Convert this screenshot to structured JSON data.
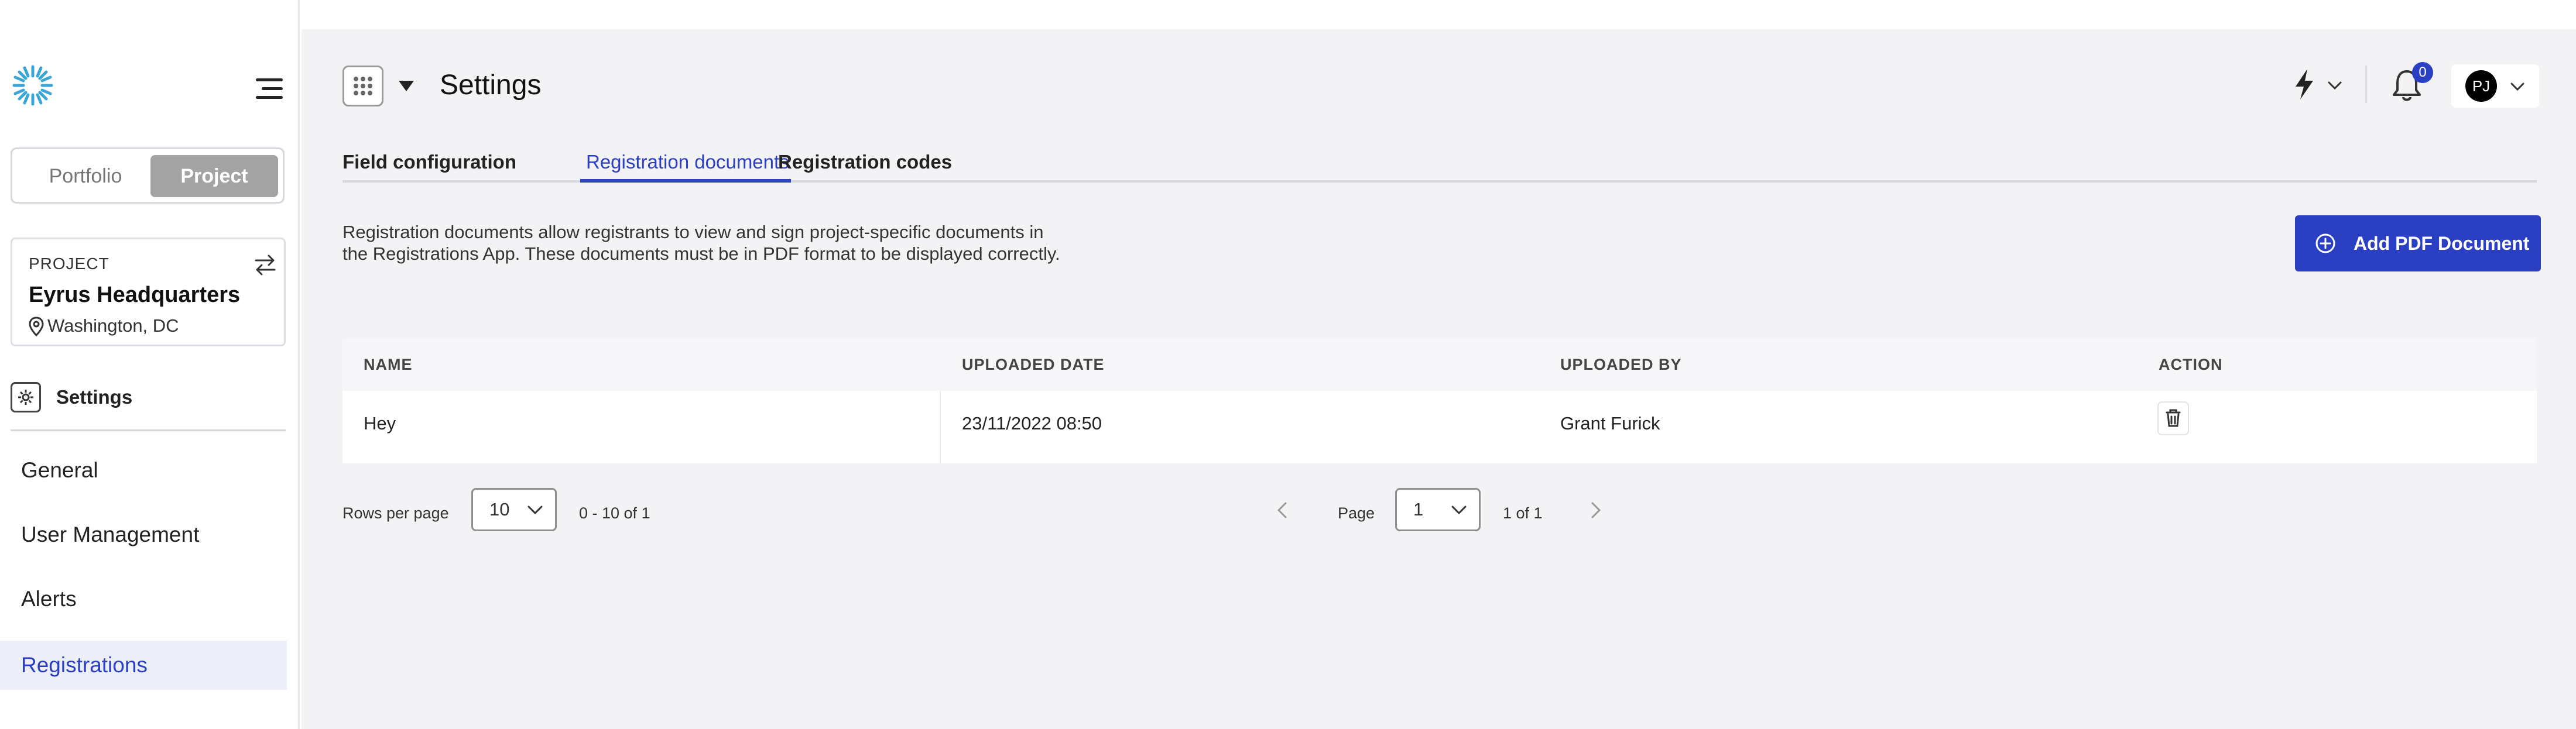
{
  "sidebar": {
    "segments": {
      "portfolio": "Portfolio",
      "project": "Project"
    },
    "project_card": {
      "label": "PROJECT",
      "name": "Eyrus Headquarters",
      "location": "Washington, DC"
    },
    "section_label": "Settings",
    "nav_items": [
      {
        "label": "General"
      },
      {
        "label": "User Management"
      },
      {
        "label": "Alerts"
      },
      {
        "label": "Registrations",
        "active": true
      }
    ]
  },
  "header": {
    "title": "Settings",
    "notification_count": "0",
    "avatar_initials": "PJ"
  },
  "tabs": [
    {
      "label": "Field configuration"
    },
    {
      "label": "Registration documents",
      "active": true
    },
    {
      "label": "Registration codes"
    }
  ],
  "description": {
    "line1": "Registration documents allow registrants to view and sign project-specific documents in",
    "line2": "the Registrations App. These documents must be in PDF format to be displayed correctly."
  },
  "add_button": {
    "label": "Add PDF Document"
  },
  "table": {
    "columns": [
      "NAME",
      "UPLOADED DATE",
      "UPLOADED BY",
      "ACTION"
    ],
    "rows": [
      {
        "name": "Hey",
        "uploaded_date": "23/11/2022 08:50",
        "uploaded_by": "Grant Furick"
      }
    ]
  },
  "pagination": {
    "rows_per_page_label": "Rows per page",
    "rows_per_page_value": "10",
    "range_text": "0 - 10 of 1",
    "page_label": "Page",
    "page_value": "1",
    "page_count_text": "1 of 1"
  },
  "colors": {
    "accent": "#2b3fc2",
    "active_nav_bg": "#eceef8",
    "main_bg": "#f3f3f6"
  },
  "icons": [
    "logo-icon",
    "hamburger-icon",
    "swap-icon",
    "location-pin-icon",
    "gear-icon",
    "app-grid-icon",
    "caret-down-icon",
    "bolt-icon",
    "chevron-down-icon",
    "bell-icon",
    "plus-circle-icon",
    "trash-icon",
    "chevron-left-icon",
    "chevron-right-icon"
  ]
}
